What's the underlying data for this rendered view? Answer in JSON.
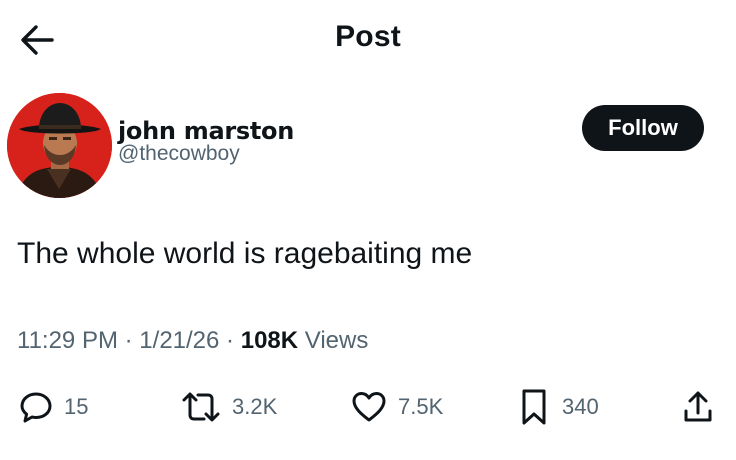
{
  "header": {
    "title": "Post",
    "back_icon": "arrow-left-icon"
  },
  "author": {
    "display_name": "john marston",
    "handle": "@thecowboy",
    "avatar_bg": "#d7221c"
  },
  "follow_label": "Follow",
  "post": {
    "text": "The whole world is ragebaiting me",
    "time": "11:29 PM",
    "date": "1/21/26",
    "views_count": "108K",
    "views_label": "Views",
    "separator": "·"
  },
  "actions": {
    "replies": {
      "icon": "reply-icon",
      "count": "15"
    },
    "reposts": {
      "icon": "repost-icon",
      "count": "3.2K"
    },
    "likes": {
      "icon": "heart-icon",
      "count": "7.5K"
    },
    "bookmarks": {
      "icon": "bookmark-icon",
      "count": "340"
    },
    "share": {
      "icon": "share-icon"
    }
  },
  "colors": {
    "text": "#0f1419",
    "secondary": "#536471",
    "button_bg": "#0f1419"
  }
}
